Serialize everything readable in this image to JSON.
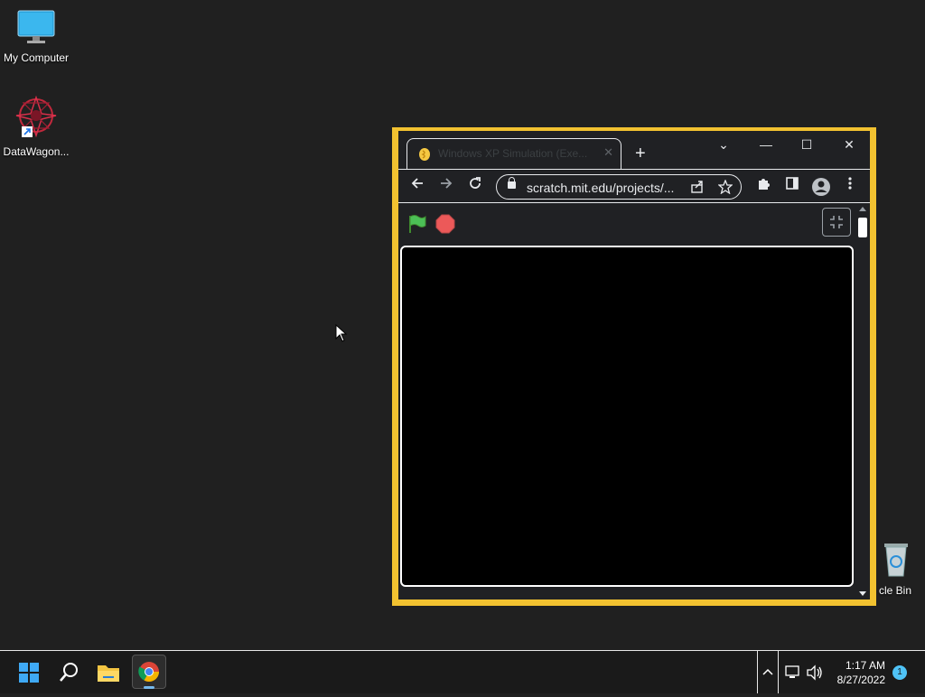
{
  "desktop": {
    "icons": [
      {
        "label": "My Computer",
        "icon": "monitor-icon"
      },
      {
        "label": "DataWagon...",
        "icon": "datawagon-icon"
      },
      {
        "label": "cle Bin",
        "icon": "recycle-bin-icon"
      }
    ]
  },
  "browser": {
    "tab_title": "Windows XP Simulation (Exe...",
    "tab_close": "✕",
    "new_tab": "+",
    "url": "scratch.mit.edu/projects/...",
    "window_controls": {
      "dropdown": "⌄",
      "minimize": "—",
      "maximize": "☐",
      "close": "✕"
    },
    "scratch": {
      "green_flag": "green-flag-icon",
      "stop": "stop-icon",
      "unfullscreen": "unfullscreen-icon"
    }
  },
  "taskbar": {
    "time": "1:17 AM",
    "date": "8/27/2022",
    "notifications": "1"
  },
  "colors": {
    "window_border": "#f2c230",
    "desktop": "#202020",
    "chrome_dark": "#202124"
  }
}
